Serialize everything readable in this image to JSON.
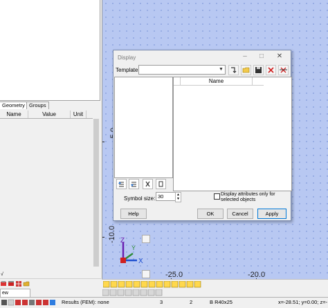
{
  "left_panel": {
    "tabs": [
      "Geometry",
      "Groups"
    ],
    "columns": [
      "Name",
      "Value",
      "Unit"
    ]
  },
  "canvas": {
    "axis_labels": [
      "-5.0",
      "-10.0",
      "-25.0",
      "-20.0"
    ],
    "triad": {
      "z": "Z",
      "y": "Y",
      "x": "X"
    }
  },
  "dialog": {
    "title": "Display",
    "template_label": "Template:",
    "template_value": "",
    "right_column_header": "Name",
    "symbol_size_label": "Symbol size:",
    "symbol_size_value": "30",
    "display_attrs_label": "Display attributes only for selected objects",
    "buttons": {
      "help": "Help",
      "ok": "OK",
      "cancel": "Cancel",
      "apply": "Apply"
    }
  },
  "bottom_left_text": "ew",
  "statusbar": {
    "results": "Results (FEM): none",
    "num1": "3",
    "num2": "2",
    "section": "B R40x25",
    "coords": "x=-28.51; y=0.00; z=-"
  },
  "colors": {
    "canvas": "#b8c8f2",
    "accent": "#0078d7",
    "axis_z": "#6a1fb0",
    "axis_y": "#2e8b3a",
    "axis_x": "#1e4fd0"
  }
}
